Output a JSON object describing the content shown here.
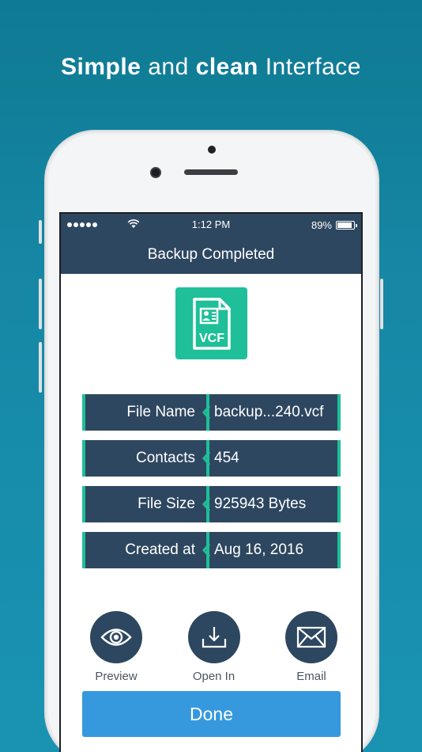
{
  "promo": {
    "word1": "Simple",
    "word2": "and",
    "word3": "clean",
    "word4": "Interface"
  },
  "status_bar": {
    "time": "1:12 PM",
    "battery": "89%",
    "battery_level": 0.89
  },
  "nav": {
    "title": "Backup Completed"
  },
  "file_icon": {
    "label": "VCF",
    "color": "#1fbf99"
  },
  "info_rows": [
    {
      "label": "File Name",
      "value": "backup...240.vcf"
    },
    {
      "label": "Contacts",
      "value": "454"
    },
    {
      "label": "File Size",
      "value": "925943 Bytes"
    },
    {
      "label": "Created at",
      "value": "Aug 16, 2016"
    }
  ],
  "actions": {
    "preview": {
      "label": "Preview",
      "icon": "eye-icon"
    },
    "open_in": {
      "label": "Open In",
      "icon": "download-icon"
    },
    "email": {
      "label": "Email",
      "icon": "envelope-icon"
    }
  },
  "done_button": {
    "label": "Done"
  },
  "colors": {
    "navy": "#2e4760",
    "accent": "#1fbf99",
    "button": "#3799dd",
    "background": "#1688a6"
  }
}
